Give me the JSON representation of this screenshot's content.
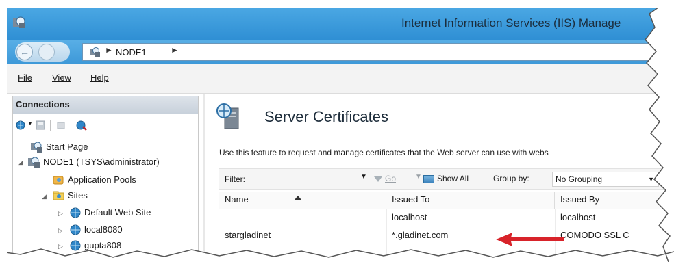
{
  "window": {
    "title": "Internet Information Services (IIS) Manage",
    "app_icon": "iis-manager-icon"
  },
  "address_bar": {
    "back_icon": "back-arrow-icon",
    "forward_icon": "forward-arrow-icon",
    "crumbs": [
      "NODE1"
    ]
  },
  "menu": {
    "items": [
      {
        "label": "File"
      },
      {
        "label": "View"
      },
      {
        "label": "Help"
      }
    ]
  },
  "connections": {
    "header": "Connections",
    "toolbar_icons": [
      "connect-globe-icon",
      "save-icon",
      "disconnect-icon",
      "refresh-icon"
    ],
    "tree": [
      {
        "label": "Start Page",
        "icon": "start-page-icon",
        "level": 0
      },
      {
        "label": "NODE1 (TSYS\\administrator)",
        "icon": "server-icon",
        "level": 0,
        "expanded": true
      },
      {
        "label": "Application Pools",
        "icon": "app-pools-icon",
        "level": 1
      },
      {
        "label": "Sites",
        "icon": "sites-folder-icon",
        "level": 1,
        "expanded": true
      },
      {
        "label": "Default Web Site",
        "icon": "globe-icon",
        "level": 2
      },
      {
        "label": "local8080",
        "icon": "globe-icon",
        "level": 2
      },
      {
        "label": "gupta808",
        "icon": "globe-icon",
        "level": 2
      }
    ]
  },
  "main": {
    "heading": "Server Certificates",
    "description": "Use this feature to request and manage certificates that the Web server can use with webs",
    "filter": {
      "label": "Filter:",
      "go_label": "Go",
      "show_all_label": "Show All",
      "group_by_label": "Group by:",
      "group_by_value": "No Grouping"
    },
    "table": {
      "columns": [
        "Name",
        "Issued To",
        "Issued By"
      ],
      "rows": [
        {
          "name": "",
          "issued_to": "localhost",
          "issued_by": "localhost"
        },
        {
          "name": "stargladinet",
          "issued_to": "*.gladinet.com",
          "issued_by": "COMODO SSL C"
        }
      ]
    },
    "annotation_arrow_color": "#d8232a"
  }
}
